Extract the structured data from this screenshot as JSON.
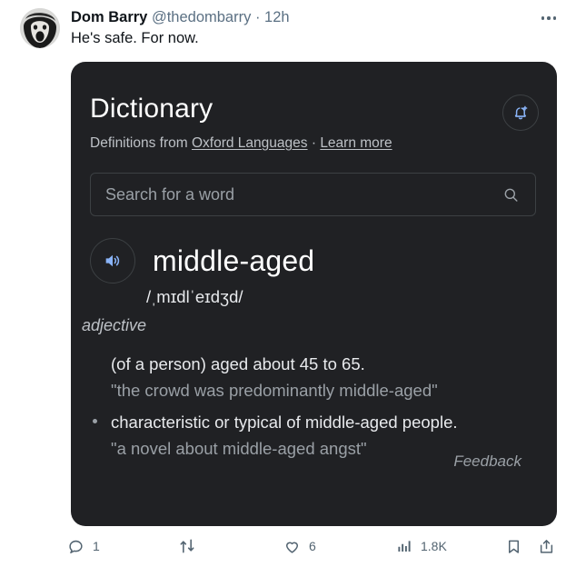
{
  "tweet": {
    "display_name": "Dom Barry",
    "handle": "@thedombarry",
    "separator": " · ",
    "timestamp": "12h",
    "text": "He's safe. For now.",
    "more_icon": "more-options-icon",
    "avatar_alt": "profile-photo"
  },
  "card": {
    "title": "Dictionary",
    "subtitle_prefix": "Definitions from ",
    "source_link": "Oxford Languages",
    "subtitle_separator": " · ",
    "learn_more_link": "Learn more",
    "notify_icon": "bell-add-icon",
    "search": {
      "placeholder": "Search for a word",
      "value": "",
      "icon": "search-icon"
    },
    "entry": {
      "headword": "middle-aged",
      "phonetic": "/ˌmɪdlˈeɪdʒd/",
      "audio_icon": "speaker-icon",
      "part_of_speech": "adjective",
      "senses": [
        {
          "definition": "(of a person) aged about 45 to 65.",
          "example": "\"the crowd was predominantly middle-aged\"",
          "bulleted": false
        },
        {
          "definition": "characteristic or typical of middle-aged people.",
          "example": "\"a novel about middle-aged angst\"",
          "bulleted": true
        }
      ]
    },
    "feedback_label": "Feedback",
    "colors": {
      "background": "#202124",
      "accent_blue": "#8ab4f8",
      "primary_text": "#e8eaed",
      "secondary_text": "#9aa0a6"
    }
  },
  "actions": {
    "reply": {
      "icon": "reply-icon",
      "count": "1"
    },
    "retweet": {
      "icon": "retweet-icon",
      "count": ""
    },
    "like": {
      "icon": "heart-icon",
      "count": "6"
    },
    "views": {
      "icon": "views-chart-icon",
      "count": "1.8K"
    },
    "bookmark": {
      "icon": "bookmark-icon",
      "count": ""
    },
    "share": {
      "icon": "share-icon",
      "count": ""
    }
  }
}
